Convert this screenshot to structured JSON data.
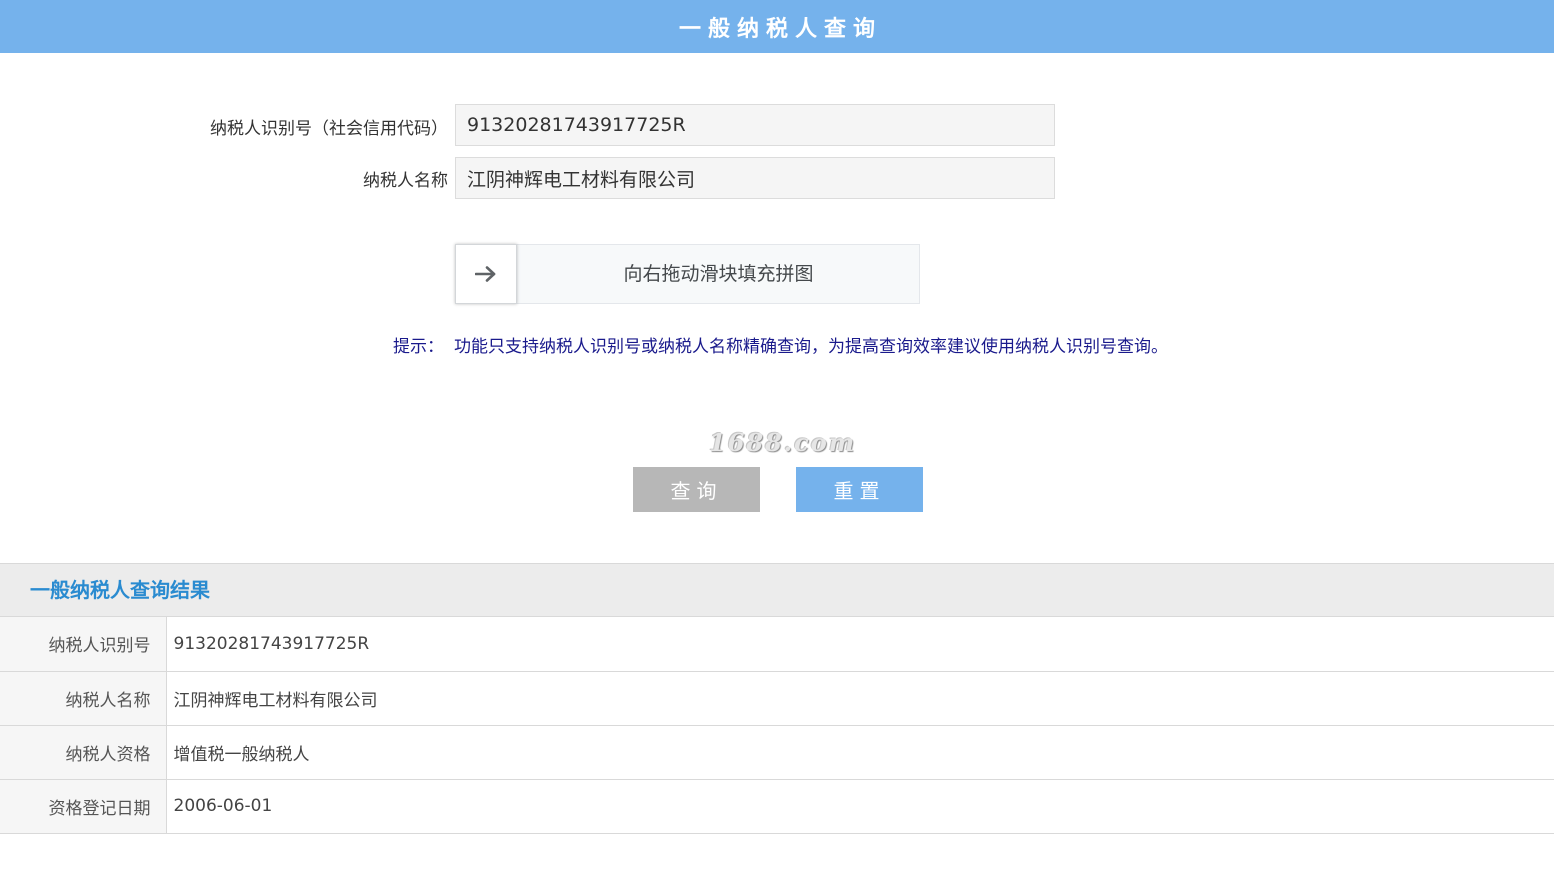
{
  "header": {
    "title": "一般纳税人查询"
  },
  "form": {
    "taxpayer_id_label": "纳税人识别号（社会信用代码）",
    "taxpayer_id_value": "91320281743917725R",
    "taxpayer_name_label": "纳税人名称",
    "taxpayer_name_value": "江阴神辉电工材料有限公司"
  },
  "slider": {
    "handle_icon": "arrow-right-icon",
    "text": "向右拖动滑块填充拼图"
  },
  "tip": {
    "label": "提示：",
    "text": "功能只支持纳税人识别号或纳税人名称精确查询，为提高查询效率建议使用纳税人识别号查询。"
  },
  "watermark": "1688.com",
  "buttons": {
    "query_label": "查询",
    "reset_label": "重置"
  },
  "result": {
    "title": "一般纳税人查询结果",
    "rows": [
      {
        "key": "纳税人识别号",
        "value": "91320281743917725R"
      },
      {
        "key": "纳税人名称",
        "value": "江阴神辉电工材料有限公司"
      },
      {
        "key": "纳税人资格",
        "value": "增值税一般纳税人"
      },
      {
        "key": "资格登记日期",
        "value": "2006-06-01"
      }
    ]
  },
  "colors": {
    "header_bg": "#75b2ec",
    "query_button_bg": "#b7b7b7",
    "reset_button_bg": "#75b2ec",
    "result_title": "#2a8bd0",
    "tip_text": "#1a1a8c"
  }
}
